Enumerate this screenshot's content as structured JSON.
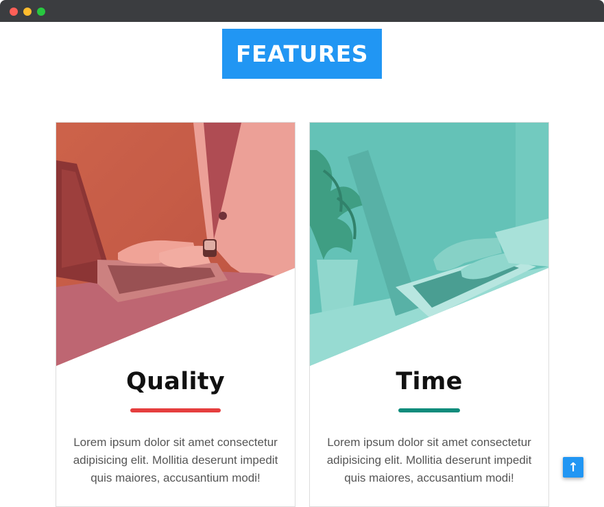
{
  "section": {
    "title": "FEATURES"
  },
  "cards": [
    {
      "title": "Quality",
      "text": "Lorem ipsum dolor sit amet consectetur adipisicing elit. Mollitia deserunt impedit quis maiores, accusantium modi!",
      "overlay_color": "#e05a4e",
      "accent_color": "#e53e3e"
    },
    {
      "title": "Time",
      "text": "Lorem ipsum dolor sit amet consectetur adipisicing elit. Mollitia deserunt impedit quis maiores, accusantium modi!",
      "overlay_color": "#4dbab0",
      "accent_color": "#0f8c7c"
    }
  ],
  "back_to_top": {
    "icon": "arrow-up-icon",
    "glyph": "↑"
  },
  "window": {
    "controls": [
      "close",
      "minimize",
      "maximize"
    ]
  }
}
